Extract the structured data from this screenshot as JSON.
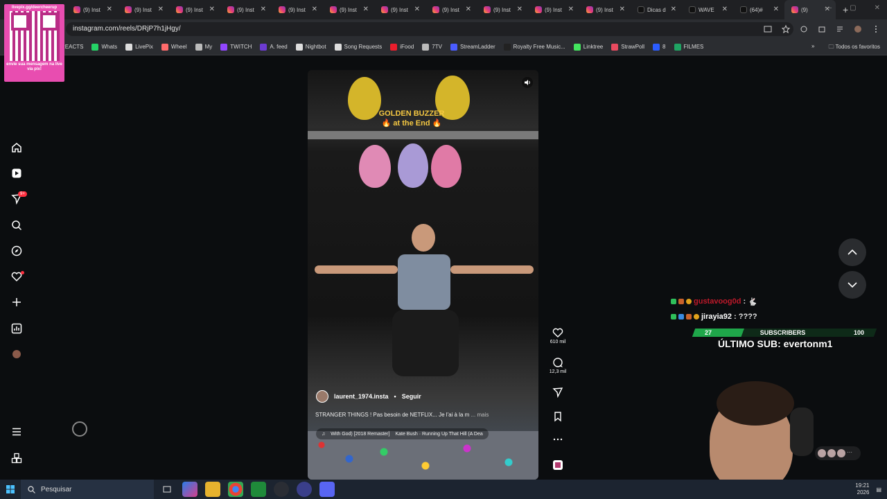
{
  "browser": {
    "tabs": [
      {
        "label": "(9) Inst",
        "favicon": "instagram-icon"
      },
      {
        "label": "(9) Inst",
        "favicon": "instagram-icon"
      },
      {
        "label": "(9) Inst",
        "favicon": "instagram-icon"
      },
      {
        "label": "(9) Inst",
        "favicon": "instagram-icon"
      },
      {
        "label": "(9) Inst",
        "favicon": "instagram-icon"
      },
      {
        "label": "(9) Inst",
        "favicon": "instagram-icon"
      },
      {
        "label": "(9) Inst",
        "favicon": "instagram-icon"
      },
      {
        "label": "(9) Inst",
        "favicon": "instagram-icon"
      },
      {
        "label": "(9) Inst",
        "favicon": "instagram-icon"
      },
      {
        "label": "(9) Inst",
        "favicon": "instagram-icon"
      },
      {
        "label": "(9) Inst",
        "favicon": "instagram-icon"
      },
      {
        "label": "Dicas d",
        "favicon": "tiktok-icon"
      },
      {
        "label": "WAVE",
        "favicon": "tiktok-icon"
      },
      {
        "label": "(64)#",
        "favicon": "tiktok-icon"
      },
      {
        "label": "(9)",
        "favicon": "instagram-icon"
      }
    ],
    "url": "instagram.com/reels/DRjP7h1jHgy/",
    "bookmarks": [
      {
        "label": "REACTS",
        "color": "#e6e6e6"
      },
      {
        "label": "Whats",
        "color": "#25d366"
      },
      {
        "label": "LivePix",
        "color": "#dddddd"
      },
      {
        "label": "Wheel",
        "color": "#ff6b6b"
      },
      {
        "label": "My",
        "color": "#bbbbbb"
      },
      {
        "label": "TWITCH",
        "color": "#9146ff"
      },
      {
        "label": "A. feed",
        "color": "#6c3bd1"
      },
      {
        "label": "Nightbot",
        "color": "#dddddd"
      },
      {
        "label": "Song Requests",
        "color": "#dddddd"
      },
      {
        "label": "iFood",
        "color": "#ea1d2c"
      },
      {
        "label": "7TV",
        "color": "#bbbbbb"
      },
      {
        "label": "StreamLadder",
        "color": "#4a5cff"
      },
      {
        "label": "Royalty Free Music...",
        "color": "#222222"
      },
      {
        "label": "Linktree",
        "color": "#43e55e"
      },
      {
        "label": "StrawPoll",
        "color": "#e84a5f"
      },
      {
        "label": "8",
        "color": "#2b5cff"
      },
      {
        "label": "FILMES",
        "color": "#1fa463"
      }
    ],
    "all_bookmarks": "Todos os favoritos",
    "more_bookmarks": "»"
  },
  "qr_overlay": {
    "top_text": "livepix.gg/deercheerup",
    "bottom_text": "envie sua mensagem na live via pix!"
  },
  "reel": {
    "overlay_title": "GOLDEN BUZZER",
    "overlay_subtitle": "🔥 at the End 🔥",
    "author": "laurent_1974.insta",
    "separator": "•",
    "follow": "Seguir",
    "caption": "STRANGER THINGS ! Pas besoin de NETFLIX... Je l'ai à la m",
    "caption_more": "... mais",
    "music_a": "With God) [2018 Remaster]",
    "music_b": "Kate Bush · Running Up That Hill (A Dea",
    "likes": "610 mil",
    "comments": "12,3 mil"
  },
  "sidebar": {
    "notification_badge": "9+"
  },
  "stream_overlay": {
    "chat": [
      {
        "user": "gustavoog0d",
        "sep": ":",
        "msg": "",
        "user_color": "#c0192a"
      },
      {
        "user": "jirayia92",
        "sep": " : ",
        "msg": "????",
        "user_color": "#ffffff"
      }
    ],
    "subs_current": "27",
    "subs_label": "SUBSCRIBERS",
    "subs_goal": "100",
    "subs_progress": 0.27,
    "last_sub": "ÚLTIMO SUB: evertonm1"
  },
  "taskbar": {
    "search_placeholder": "Pesquisar",
    "time": "19:21",
    "date": "2026"
  }
}
